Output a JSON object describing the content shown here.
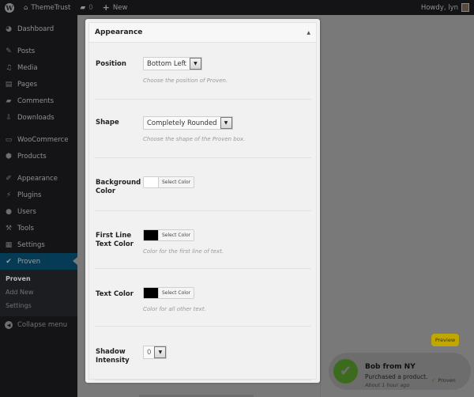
{
  "adminbar": {
    "site_name": "ThemeTrust",
    "comments_count": "0",
    "new_label": "New",
    "greeting": "Howdy, lyn"
  },
  "sidebar": {
    "items": [
      {
        "label": "Dashboard",
        "icon": "dashboard-icon"
      },
      {
        "label": "Posts",
        "icon": "pin-icon"
      },
      {
        "label": "Media",
        "icon": "media-icon"
      },
      {
        "label": "Pages",
        "icon": "pages-icon"
      },
      {
        "label": "Comments",
        "icon": "comment-icon"
      },
      {
        "label": "Downloads",
        "icon": "download-icon"
      },
      {
        "label": "WooCommerce",
        "icon": "woocommerce-icon"
      },
      {
        "label": "Products",
        "icon": "products-icon"
      },
      {
        "label": "Appearance",
        "icon": "brush-icon"
      },
      {
        "label": "Plugins",
        "icon": "plugin-icon"
      },
      {
        "label": "Users",
        "icon": "user-icon"
      },
      {
        "label": "Tools",
        "icon": "wrench-icon"
      },
      {
        "label": "Settings",
        "icon": "settings-icon"
      },
      {
        "label": "Proven",
        "icon": "check-icon"
      }
    ],
    "submenu": [
      "Proven",
      "Add New",
      "Settings"
    ],
    "collapse_label": "Collapse menu"
  },
  "panel": {
    "title": "Appearance",
    "fields": {
      "position": {
        "label": "Position",
        "value": "Bottom Left",
        "description": "Choose the position of Proven."
      },
      "shape": {
        "label": "Shape",
        "value": "Completely Rounded",
        "description": "Choose the shape of the Proven box."
      },
      "background_color": {
        "label_line1": "Background",
        "label_line2": "Color",
        "button": "Select Color",
        "color": "#ffffff"
      },
      "first_line_color": {
        "label_line1": "First Line",
        "label_line2": "Text Color",
        "button": "Select Color",
        "color": "#000000",
        "description": "Color for the first line of text."
      },
      "text_color": {
        "label": "Text Color",
        "button": "Select Color",
        "color": "#000000",
        "description": "Color for all other text."
      },
      "shadow_intensity": {
        "label_line1": "Shadow",
        "label_line2": "Intensity",
        "value": "0"
      }
    }
  },
  "preview": {
    "button": "Preview",
    "notification": {
      "name": "Bob from NY",
      "action": "Purchased a product.",
      "time": "About 1 hour ago",
      "brand": "Proven"
    }
  }
}
